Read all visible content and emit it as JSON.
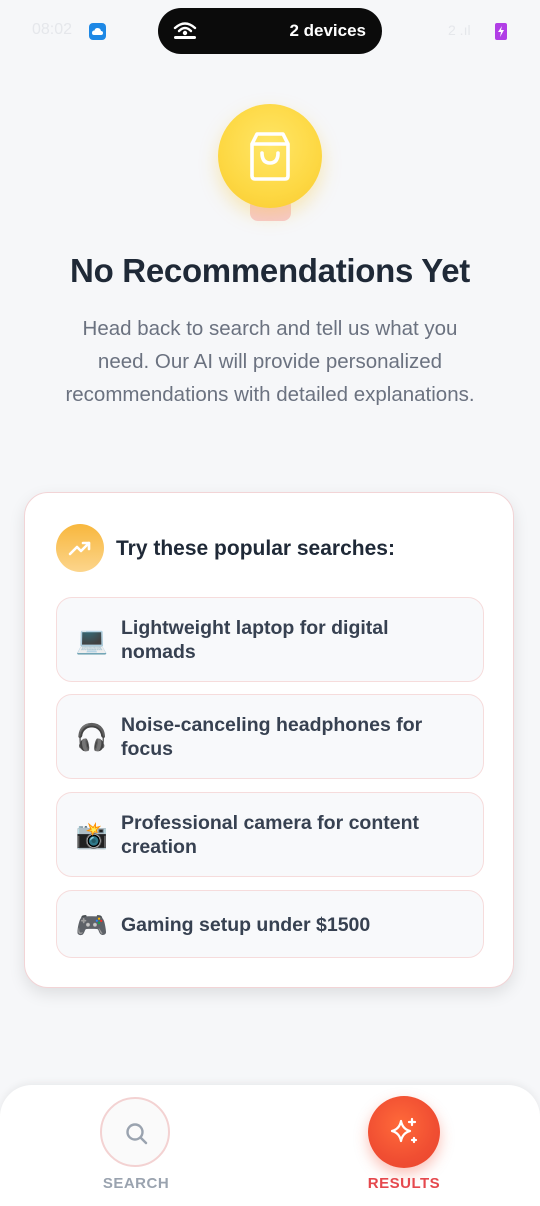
{
  "status_bar": {
    "time": "08:02",
    "hotspot_text": "2 devices",
    "signal_text": "2 .ıl"
  },
  "hero": {
    "icon": "shopping-bag-icon",
    "title": "No Recommendations Yet",
    "description": "Head back to search and tell us what you need. Our AI will provide personalized recommendations with detailed explanations."
  },
  "suggestions_card": {
    "icon": "trending-up-icon",
    "title": "Try these popular searches:",
    "items": [
      {
        "emoji": "💻",
        "label": "Lightweight laptop for digital nomads"
      },
      {
        "emoji": "🎧",
        "label": "Noise-canceling headphones for focus"
      },
      {
        "emoji": "📸",
        "label": "Professional camera for content creation"
      },
      {
        "emoji": "🎮",
        "label": "Gaming setup under $1500"
      }
    ]
  },
  "bottom_nav": {
    "items": [
      {
        "label": "SEARCH",
        "icon": "search-icon",
        "active": false
      },
      {
        "label": "RESULTS",
        "icon": "sparkles-icon",
        "active": true
      }
    ]
  },
  "colors": {
    "accent": "#f04e32",
    "active_label": "#e5484d",
    "inactive_label": "#9aa3af",
    "hero_yellow": "#fdd843",
    "card_border": "#f2d4d6"
  }
}
